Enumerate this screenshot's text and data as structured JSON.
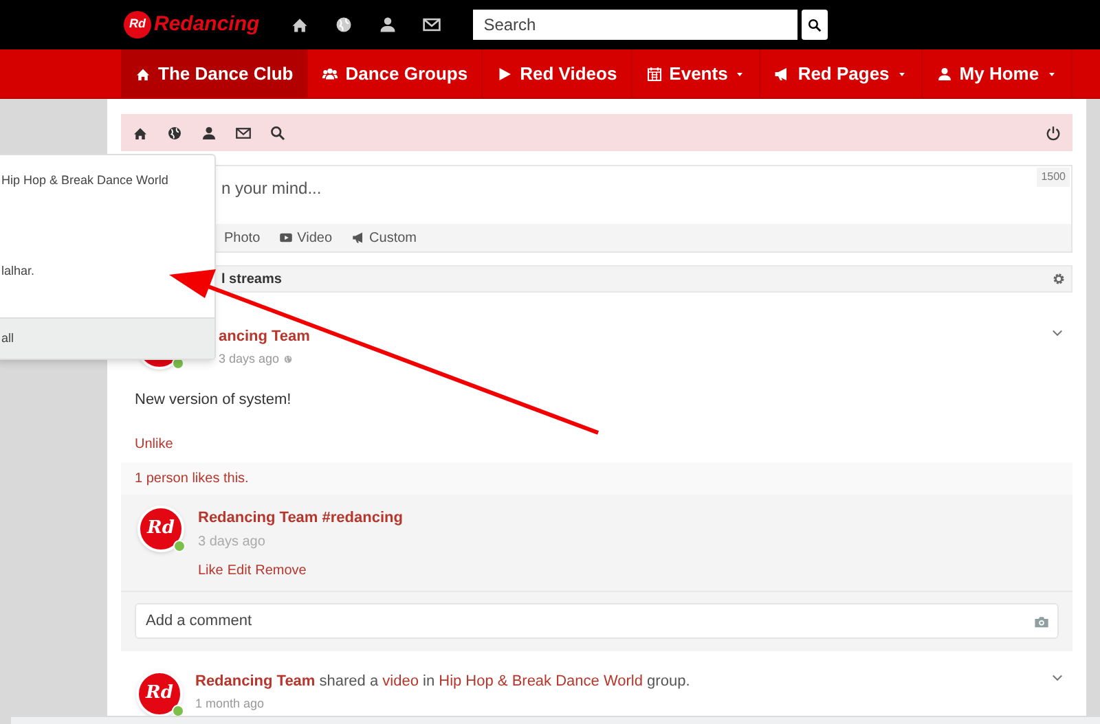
{
  "topbar": {
    "logo_badge": "Rd",
    "logo": "Redancing",
    "search": {
      "placeholder": "Search"
    }
  },
  "nav": [
    {
      "label": "The Dance Club",
      "selected": true,
      "dropdown": false
    },
    {
      "label": "Dance Groups",
      "selected": false,
      "dropdown": false
    },
    {
      "label": "Red Videos",
      "selected": false,
      "dropdown": false
    },
    {
      "label": "Events",
      "selected": false,
      "dropdown": true
    },
    {
      "label": "Red Pages",
      "selected": false,
      "dropdown": true
    },
    {
      "label": "My Home",
      "selected": false,
      "dropdown": true
    }
  ],
  "composer": {
    "placeholder": "n your mind...",
    "counter": "1500",
    "actions": [
      "Photo",
      "Video",
      "Custom"
    ]
  },
  "streams": {
    "title": "l streams"
  },
  "post": {
    "author": "ancing Team",
    "time": "3 days ago",
    "text": "New version of system!",
    "action": "Unlike",
    "likes": "1 person likes this.",
    "comment": {
      "avatar": "Rd",
      "author": "Redancing Team #redancing",
      "time": "3 days ago",
      "actions": [
        "Like",
        "Edit",
        "Remove"
      ]
    },
    "comment_field": {
      "placeholder": "Add a comment"
    }
  },
  "post2": {
    "avatar": "Rd",
    "headline": [
      {
        "kind": "link",
        "text": "Redancing Team"
      },
      {
        "kind": "text",
        "text": " shared a "
      },
      {
        "kind": "link",
        "text": "video"
      },
      {
        "kind": "text",
        "text": " in "
      },
      {
        "kind": "link",
        "text": "Hip Hop & Break Dance World"
      },
      {
        "kind": "text",
        "text": " group."
      }
    ],
    "time": "1 month ago"
  },
  "popup": {
    "lines": [
      "Hip Hop & Break Dance World",
      "lalhar."
    ],
    "footer": "all"
  }
}
